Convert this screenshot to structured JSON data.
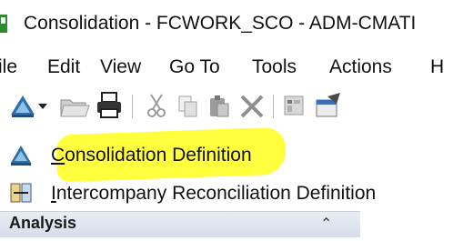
{
  "window": {
    "title": "Consolidation - FCWORK_SCO - ADM-CMATI"
  },
  "menu": [
    "ile",
    "Edit",
    "View",
    "Go To",
    "Tools",
    "Actions",
    "H"
  ],
  "toolbar": {
    "buttons": [
      "consolidation-icon",
      "dropdown-arrow-icon",
      "open-folder-icon",
      "print-icon",
      "cut-icon",
      "copy-icon",
      "paste-icon",
      "delete-icon",
      "grid-icon",
      "properties-icon"
    ]
  },
  "dropdown": {
    "items": [
      {
        "first": "C",
        "rest": "onsolidation Definition",
        "icon": "consolidation-icon",
        "highlighted": true
      },
      {
        "first": "I",
        "rest": "ntercompany Reconciliation Definition",
        "icon": "reconciliation-icon",
        "highlighted": false
      }
    ]
  },
  "panel": {
    "title": "Analysis",
    "toggle": "⌃"
  },
  "colors": {
    "highlight": "#ffff33",
    "panel": "#dbe2ec"
  }
}
